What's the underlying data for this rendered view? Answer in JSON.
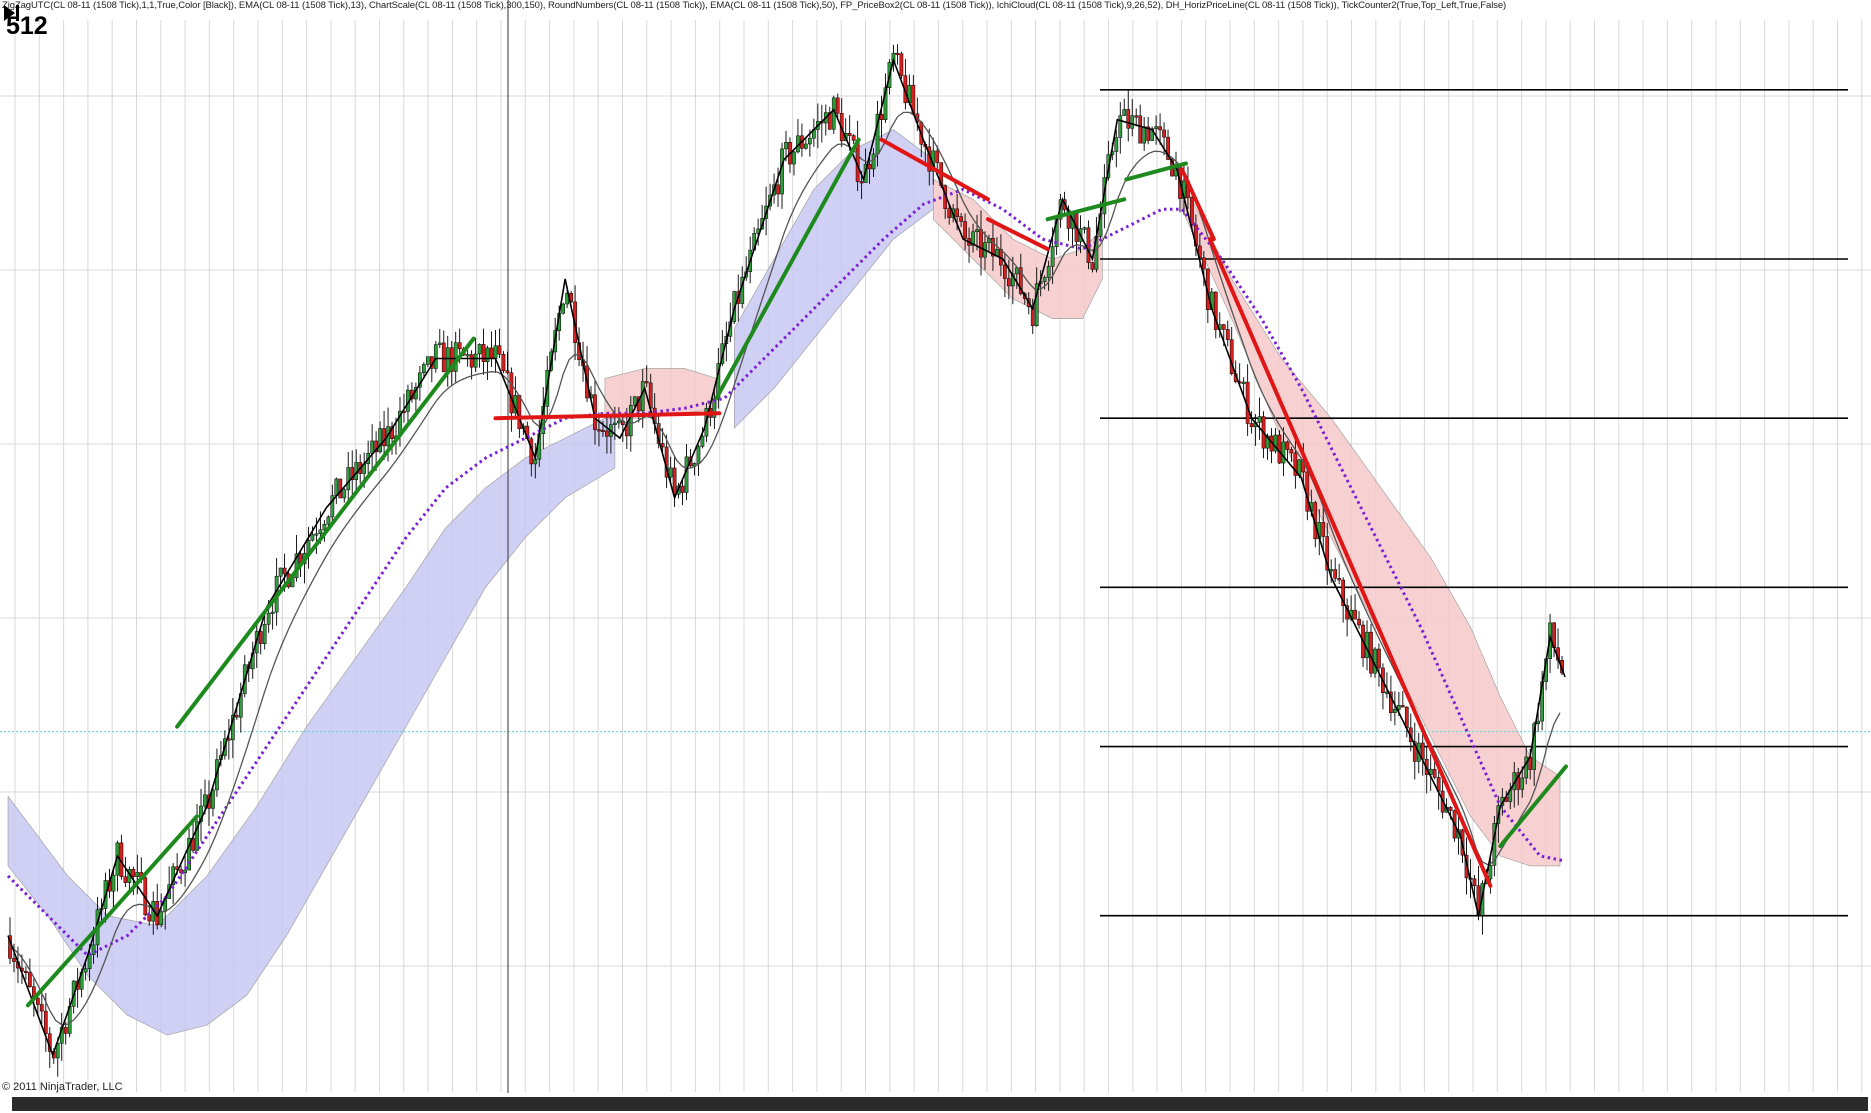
{
  "header": {
    "indicators": "ZigZagUTC(CL 08-11 (1508 Tick),1,1,True,Color [Black]), EMA(CL 08-11 (1508 Tick),13), ChartScale(CL 08-11 (1508 Tick),300,150), RoundNumbers(CL 08-11 (1508 Tick)), EMA(CL 08-11 (1508 Tick),50), FP_PriceBox2(CL 08-11 (1508 Tick)), IchiCloud(CL 08-11 (1508 Tick),9,26,52), DH_HorizPriceLine(CL 08-11 (1508 Tick)), TickCounter2(True,Top_Left,True,False)",
    "tick_counter": "512"
  },
  "footer": {
    "copyright": "© 2011 NinjaTrader, LLC"
  },
  "colors": {
    "background": "#ffffff",
    "grid": "#d8d8d8",
    "up_candle": "#2e9e3a",
    "down_candle": "#d61f1f",
    "price_line": "#000000",
    "ema13": "#555555",
    "ema50": "#7b1fd6",
    "cloud_bull": "#c8c8f4",
    "cloud_bear": "#f6c9c9",
    "round_number_line": "#000000",
    "current_price_line": "#4fd7d7",
    "trend_up": "#1e8a1e",
    "trend_down": "#e01515"
  },
  "chart_data": {
    "type": "candlestick",
    "instrument": "CL 08-11 (1508 Tick)",
    "grid": true,
    "ema50": [
      [
        0,
        0.18
      ],
      [
        40,
        0.14
      ],
      [
        80,
        0.1
      ],
      [
        120,
        0.12
      ],
      [
        160,
        0.16
      ],
      [
        200,
        0.22
      ],
      [
        240,
        0.28
      ],
      [
        280,
        0.34
      ],
      [
        320,
        0.4
      ],
      [
        360,
        0.46
      ],
      [
        400,
        0.52
      ],
      [
        440,
        0.57
      ],
      [
        480,
        0.6
      ],
      [
        520,
        0.62
      ],
      [
        560,
        0.64
      ],
      [
        600,
        0.645
      ],
      [
        640,
        0.645
      ],
      [
        680,
        0.65
      ],
      [
        720,
        0.66
      ],
      [
        760,
        0.7
      ],
      [
        800,
        0.74
      ],
      [
        840,
        0.78
      ],
      [
        880,
        0.82
      ],
      [
        920,
        0.855
      ],
      [
        960,
        0.87
      ],
      [
        1000,
        0.85
      ],
      [
        1040,
        0.82
      ],
      [
        1080,
        0.81
      ],
      [
        1120,
        0.83
      ],
      [
        1160,
        0.85
      ],
      [
        1180,
        0.85
      ],
      [
        1220,
        0.8
      ],
      [
        1260,
        0.74
      ],
      [
        1300,
        0.67
      ],
      [
        1340,
        0.59
      ],
      [
        1380,
        0.51
      ],
      [
        1420,
        0.43
      ],
      [
        1460,
        0.34
      ],
      [
        1500,
        0.25
      ],
      [
        1540,
        0.2
      ],
      [
        1565,
        0.195
      ]
    ],
    "cloud_bull": [
      [
        [
          0,
          0.26
        ],
        [
          30,
          0.22
        ],
        [
          60,
          0.18
        ],
        [
          100,
          0.14
        ],
        [
          150,
          0.13
        ],
        [
          200,
          0.18
        ],
        [
          250,
          0.25
        ],
        [
          300,
          0.33
        ],
        [
          350,
          0.4
        ],
        [
          400,
          0.47
        ],
        [
          440,
          0.53
        ],
        [
          480,
          0.57
        ],
        [
          520,
          0.6
        ],
        [
          560,
          0.62
        ],
        [
          600,
          0.64
        ],
        [
          610,
          0.64
        ]
      ],
      [
        [
          0,
          0.19
        ],
        [
          40,
          0.14
        ],
        [
          80,
          0.08
        ],
        [
          120,
          0.04
        ],
        [
          160,
          0.02
        ],
        [
          200,
          0.03
        ],
        [
          240,
          0.06
        ],
        [
          280,
          0.12
        ],
        [
          320,
          0.19
        ],
        [
          360,
          0.26
        ],
        [
          400,
          0.33
        ],
        [
          440,
          0.4
        ],
        [
          480,
          0.47
        ],
        [
          520,
          0.52
        ],
        [
          560,
          0.56
        ],
        [
          610,
          0.59
        ]
      ]
    ],
    "cloud_bear": [
      [
        [
          930,
          0.88
        ],
        [
          970,
          0.86
        ],
        [
          1010,
          0.82
        ],
        [
          1050,
          0.8
        ],
        [
          1080,
          0.81
        ],
        [
          1100,
          0.83
        ]
      ],
      [
        [
          930,
          0.84
        ],
        [
          970,
          0.8
        ],
        [
          1010,
          0.76
        ],
        [
          1050,
          0.74
        ],
        [
          1080,
          0.74
        ],
        [
          1100,
          0.78
        ]
      ]
    ],
    "round_numbers": [
      0.97,
      0.8,
      0.64,
      0.47,
      0.31,
      0.14
    ],
    "current_price": 0.325,
    "zigzag": [
      [
        0,
        0.12
      ],
      [
        45,
        0.0
      ],
      [
        80,
        0.1
      ],
      [
        110,
        0.2
      ],
      [
        150,
        0.14
      ],
      [
        200,
        0.25
      ],
      [
        260,
        0.45
      ],
      [
        320,
        0.55
      ],
      [
        380,
        0.62
      ],
      [
        430,
        0.7
      ],
      [
        490,
        0.7
      ],
      [
        530,
        0.6
      ],
      [
        560,
        0.78
      ],
      [
        590,
        0.64
      ],
      [
        615,
        0.62
      ],
      [
        640,
        0.67
      ],
      [
        670,
        0.56
      ],
      [
        700,
        0.63
      ],
      [
        730,
        0.75
      ],
      [
        780,
        0.9
      ],
      [
        830,
        0.95
      ],
      [
        860,
        0.88
      ],
      [
        890,
        1.0
      ],
      [
        920,
        0.92
      ],
      [
        960,
        0.82
      ],
      [
        1000,
        0.8
      ],
      [
        1030,
        0.75
      ],
      [
        1060,
        0.86
      ],
      [
        1090,
        0.8
      ],
      [
        1115,
        0.94
      ],
      [
        1150,
        0.93
      ],
      [
        1175,
        0.89
      ],
      [
        1210,
        0.75
      ],
      [
        1250,
        0.64
      ],
      [
        1300,
        0.58
      ],
      [
        1330,
        0.48
      ],
      [
        1370,
        0.4
      ],
      [
        1420,
        0.3
      ],
      [
        1460,
        0.22
      ],
      [
        1478,
        0.14
      ],
      [
        1500,
        0.25
      ],
      [
        1530,
        0.3
      ],
      [
        1550,
        0.42
      ],
      [
        1565,
        0.38
      ]
    ],
    "trend_lines": [
      {
        "direction": "up",
        "from": [
          20,
          0.05
        ],
        "to": [
          190,
          0.24
        ]
      },
      {
        "direction": "up",
        "from": [
          170,
          0.33
        ],
        "to": [
          468,
          0.72
        ]
      },
      {
        "direction": "flat",
        "from": [
          490,
          0.64
        ],
        "to": [
          715,
          0.645
        ]
      },
      {
        "direction": "up",
        "from": [
          712,
          0.66
        ],
        "to": [
          855,
          0.92
        ]
      },
      {
        "direction": "down",
        "from": [
          878,
          0.92
        ],
        "to": [
          985,
          0.86
        ]
      },
      {
        "direction": "down",
        "from": [
          985,
          0.84
        ],
        "to": [
          1045,
          0.81
        ]
      },
      {
        "direction": "up",
        "from": [
          1045,
          0.84
        ],
        "to": [
          1122,
          0.86
        ]
      },
      {
        "direction": "up",
        "from": [
          1124,
          0.88
        ],
        "to": [
          1184,
          0.896
        ]
      },
      {
        "direction": "down",
        "from": [
          1180,
          0.89
        ],
        "to": [
          1212,
          0.82
        ]
      },
      {
        "direction": "down",
        "from": [
          1208,
          0.82
        ],
        "to": [
          1490,
          0.17
        ]
      },
      {
        "direction": "up",
        "from": [
          1500,
          0.21
        ],
        "to": [
          1566,
          0.29
        ]
      }
    ]
  }
}
